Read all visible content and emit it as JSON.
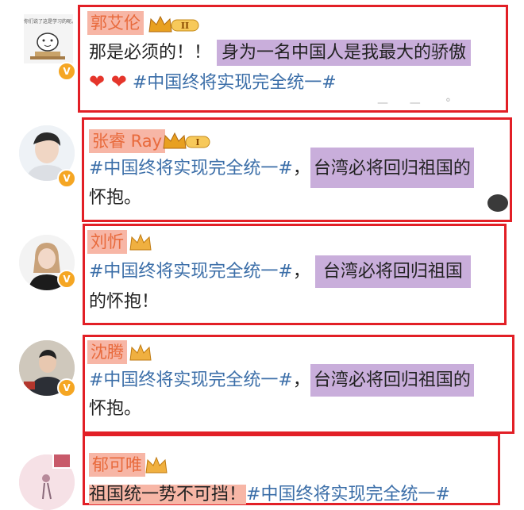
{
  "posts": [
    {
      "name": "郭艾伦",
      "level": "II",
      "avatar_caption": "你们说了这是学习的呢。",
      "line1_plain": "那是必须的！！",
      "line1_hl": "身为一名中国人是我最大的骄傲",
      "hearts": "❤ ❤",
      "line2_tag": "#中国终将实现完全统一#"
    },
    {
      "name": "张睿 Ray",
      "level": "I",
      "line1_tag": "#中国终将实现完全统一#",
      "line1_plain": "，",
      "line1_hl": "台湾必将回归祖国的",
      "line2_hl": "怀抱。"
    },
    {
      "name": "刘忻",
      "line1_tag": "#中国终将实现完全统一#",
      "line1_plain": "，",
      "line1_hl": "台湾必将回归祖国",
      "line2_plain": "的怀抱！"
    },
    {
      "name": "沈腾",
      "line1_tag": "#中国终将实现完全统一#",
      "line1_plain": "，",
      "line1_hl": "台湾必将回归祖国的",
      "line2_hl": "怀抱。"
    },
    {
      "name": "郁可唯",
      "line1_plain": "祖国统一势不可挡！",
      "line1_tag": "#中国终将实现完全统一#"
    }
  ],
  "colors": {
    "box_border": "#e21f26",
    "name_highlight": "#f7b6a6",
    "text_highlight": "#c9aedb",
    "hashtag": "#3b6ea8",
    "vip_badge": "#f5a623"
  }
}
